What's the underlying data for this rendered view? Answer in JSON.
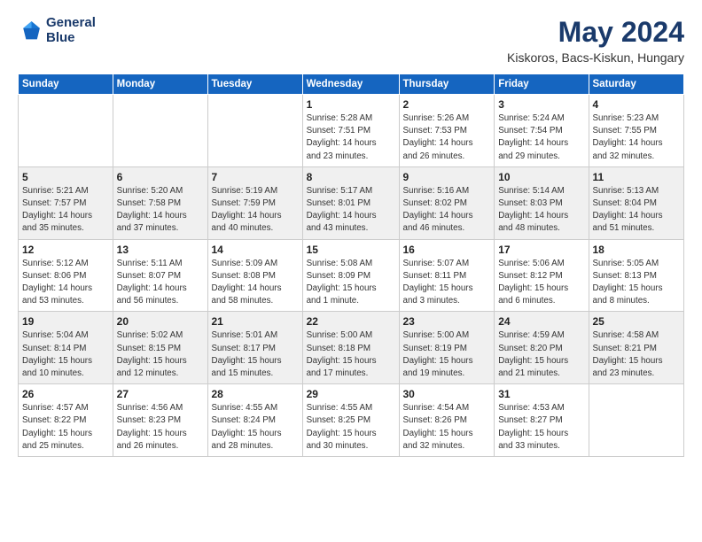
{
  "header": {
    "logo_line1": "General",
    "logo_line2": "Blue",
    "title": "May 2024",
    "subtitle": "Kiskoros, Bacs-Kiskun, Hungary"
  },
  "days_of_week": [
    "Sunday",
    "Monday",
    "Tuesday",
    "Wednesday",
    "Thursday",
    "Friday",
    "Saturday"
  ],
  "weeks": [
    [
      {
        "day": "",
        "info": ""
      },
      {
        "day": "",
        "info": ""
      },
      {
        "day": "",
        "info": ""
      },
      {
        "day": "1",
        "info": "Sunrise: 5:28 AM\nSunset: 7:51 PM\nDaylight: 14 hours\nand 23 minutes."
      },
      {
        "day": "2",
        "info": "Sunrise: 5:26 AM\nSunset: 7:53 PM\nDaylight: 14 hours\nand 26 minutes."
      },
      {
        "day": "3",
        "info": "Sunrise: 5:24 AM\nSunset: 7:54 PM\nDaylight: 14 hours\nand 29 minutes."
      },
      {
        "day": "4",
        "info": "Sunrise: 5:23 AM\nSunset: 7:55 PM\nDaylight: 14 hours\nand 32 minutes."
      }
    ],
    [
      {
        "day": "5",
        "info": "Sunrise: 5:21 AM\nSunset: 7:57 PM\nDaylight: 14 hours\nand 35 minutes."
      },
      {
        "day": "6",
        "info": "Sunrise: 5:20 AM\nSunset: 7:58 PM\nDaylight: 14 hours\nand 37 minutes."
      },
      {
        "day": "7",
        "info": "Sunrise: 5:19 AM\nSunset: 7:59 PM\nDaylight: 14 hours\nand 40 minutes."
      },
      {
        "day": "8",
        "info": "Sunrise: 5:17 AM\nSunset: 8:01 PM\nDaylight: 14 hours\nand 43 minutes."
      },
      {
        "day": "9",
        "info": "Sunrise: 5:16 AM\nSunset: 8:02 PM\nDaylight: 14 hours\nand 46 minutes."
      },
      {
        "day": "10",
        "info": "Sunrise: 5:14 AM\nSunset: 8:03 PM\nDaylight: 14 hours\nand 48 minutes."
      },
      {
        "day": "11",
        "info": "Sunrise: 5:13 AM\nSunset: 8:04 PM\nDaylight: 14 hours\nand 51 minutes."
      }
    ],
    [
      {
        "day": "12",
        "info": "Sunrise: 5:12 AM\nSunset: 8:06 PM\nDaylight: 14 hours\nand 53 minutes."
      },
      {
        "day": "13",
        "info": "Sunrise: 5:11 AM\nSunset: 8:07 PM\nDaylight: 14 hours\nand 56 minutes."
      },
      {
        "day": "14",
        "info": "Sunrise: 5:09 AM\nSunset: 8:08 PM\nDaylight: 14 hours\nand 58 minutes."
      },
      {
        "day": "15",
        "info": "Sunrise: 5:08 AM\nSunset: 8:09 PM\nDaylight: 15 hours\nand 1 minute."
      },
      {
        "day": "16",
        "info": "Sunrise: 5:07 AM\nSunset: 8:11 PM\nDaylight: 15 hours\nand 3 minutes."
      },
      {
        "day": "17",
        "info": "Sunrise: 5:06 AM\nSunset: 8:12 PM\nDaylight: 15 hours\nand 6 minutes."
      },
      {
        "day": "18",
        "info": "Sunrise: 5:05 AM\nSunset: 8:13 PM\nDaylight: 15 hours\nand 8 minutes."
      }
    ],
    [
      {
        "day": "19",
        "info": "Sunrise: 5:04 AM\nSunset: 8:14 PM\nDaylight: 15 hours\nand 10 minutes."
      },
      {
        "day": "20",
        "info": "Sunrise: 5:02 AM\nSunset: 8:15 PM\nDaylight: 15 hours\nand 12 minutes."
      },
      {
        "day": "21",
        "info": "Sunrise: 5:01 AM\nSunset: 8:17 PM\nDaylight: 15 hours\nand 15 minutes."
      },
      {
        "day": "22",
        "info": "Sunrise: 5:00 AM\nSunset: 8:18 PM\nDaylight: 15 hours\nand 17 minutes."
      },
      {
        "day": "23",
        "info": "Sunrise: 5:00 AM\nSunset: 8:19 PM\nDaylight: 15 hours\nand 19 minutes."
      },
      {
        "day": "24",
        "info": "Sunrise: 4:59 AM\nSunset: 8:20 PM\nDaylight: 15 hours\nand 21 minutes."
      },
      {
        "day": "25",
        "info": "Sunrise: 4:58 AM\nSunset: 8:21 PM\nDaylight: 15 hours\nand 23 minutes."
      }
    ],
    [
      {
        "day": "26",
        "info": "Sunrise: 4:57 AM\nSunset: 8:22 PM\nDaylight: 15 hours\nand 25 minutes."
      },
      {
        "day": "27",
        "info": "Sunrise: 4:56 AM\nSunset: 8:23 PM\nDaylight: 15 hours\nand 26 minutes."
      },
      {
        "day": "28",
        "info": "Sunrise: 4:55 AM\nSunset: 8:24 PM\nDaylight: 15 hours\nand 28 minutes."
      },
      {
        "day": "29",
        "info": "Sunrise: 4:55 AM\nSunset: 8:25 PM\nDaylight: 15 hours\nand 30 minutes."
      },
      {
        "day": "30",
        "info": "Sunrise: 4:54 AM\nSunset: 8:26 PM\nDaylight: 15 hours\nand 32 minutes."
      },
      {
        "day": "31",
        "info": "Sunrise: 4:53 AM\nSunset: 8:27 PM\nDaylight: 15 hours\nand 33 minutes."
      },
      {
        "day": "",
        "info": ""
      }
    ]
  ]
}
